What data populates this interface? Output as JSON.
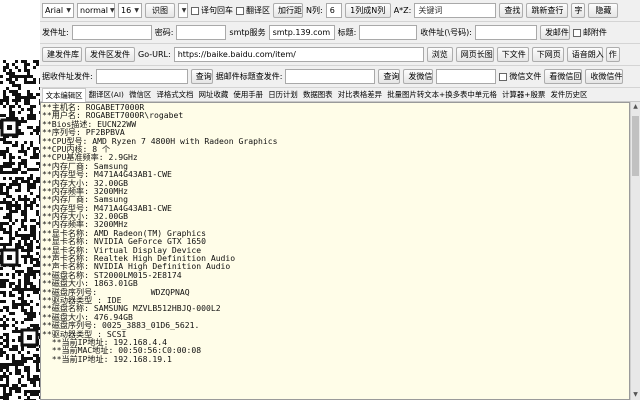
{
  "row1": {
    "font": "Arial",
    "weight": "normal",
    "size": "16",
    "btn_shidu": "识图",
    "chk_wrap": "译句回车",
    "chk_translate": "翻译区",
    "btn_add_row": "加行距",
    "n_label": "N列:",
    "n_value": "6",
    "btn_n_to_1": "1列成N列",
    "search_label": "A*Z:",
    "search_placeholder": "关键词",
    "btn_find": "查找",
    "btn_new_find": "跳新查行",
    "font_btn": "字",
    "btn_hide": "隐藏"
  },
  "row2": {
    "sender_label": "发件址:",
    "pwd_label": "密码:",
    "smtp_label": "smtp服务",
    "smtp_value": "smtp.139.com",
    "subject_label": "标题:",
    "receiver_label": "收件址(\\号码):",
    "btn_send": "发邮件",
    "chk_mail_attach": "邮附件"
  },
  "row3": {
    "btn_build": "建发件库",
    "btn_build_area": "发件区发件",
    "go_label": "Go-URL:",
    "url": "https://baike.baidu.com/item/",
    "btn_browse": "浏览",
    "btn_page_table": "网页长图",
    "btn_download": "下文件",
    "btn_webpage": "下网页",
    "btn_tts": "语音朗入",
    "btn_more": "作"
  },
  "row4": {
    "label_recv_area": "据收件址发件:",
    "btn_query": "查询",
    "label_mail_content": "据邮件标题查发件:",
    "btn_query2": "查询",
    "btn_wechat": "发微信",
    "chk_wechat_attach": "微信文件",
    "btn_reply": "看微信回",
    "btn_collect": "收微信件"
  },
  "tabs": [
    "文本编辑区",
    "翻译区(AI)",
    "微信区",
    "译格式文档",
    "网址收藏",
    "使用手册",
    "日历计划",
    "数据图表",
    "对比表格差异",
    "批量图片转文本+换多表中单元格",
    "计算器+殷票",
    "发件历史区"
  ],
  "editor_lines": [
    "**主机名: ROGABET7000R",
    "**用户名: ROGABET7000R\\rogabet",
    "**Bios描述: EUCN22WW",
    "**序列号: PF2BPBVA",
    "**CPU型号: AMD Ryzen 7 4800H with Radeon Graphics",
    "**CPU内核: 8 个",
    "**CPU基准频率: 2.9GHz",
    "**内存厂商: Samsung",
    "**内存型号: M471A4G43AB1-CWE",
    "**内存大小: 32.00GB",
    "**内存频率: 3200MHz",
    "**内存厂商: Samsung",
    "**内存型号: M471A4G43AB1-CWE",
    "**内存大小: 32.00GB",
    "**内存频率: 3200MHz",
    "**显卡名称: AMD Radeon(TM) Graphics",
    "**显卡名称: NVIDIA GeForce GTX 1650",
    "**显卡名称: Virtual Display Device",
    "**声卡名称: Realtek High Definition Audio",
    "**声卡名称: NVIDIA High Definition Audio",
    "**磁盘名称: ST2000LM015-2E8174",
    "**磁盘大小: 1863.01GB",
    "**磁盘序列号:           WDZQPNAQ",
    "**驱动器类型 : IDE",
    "**磁盘名称: SAMSUNG MZVLB512HBJQ-000L2",
    "**磁盘大小: 476.94GB",
    "**磁盘序列号: 0025_3883_01D6_5621.",
    "**驱动器类型 : SCSI",
    "  **当前IP地址: 192.168.4.4",
    "  **当前MAC地址: 00:50:56:C0:00:08",
    "  **当前IP地址: 192.168.19.1"
  ],
  "colors": {
    "editor_bg": "#fffde8",
    "window_bg": "#f0f0f0"
  }
}
